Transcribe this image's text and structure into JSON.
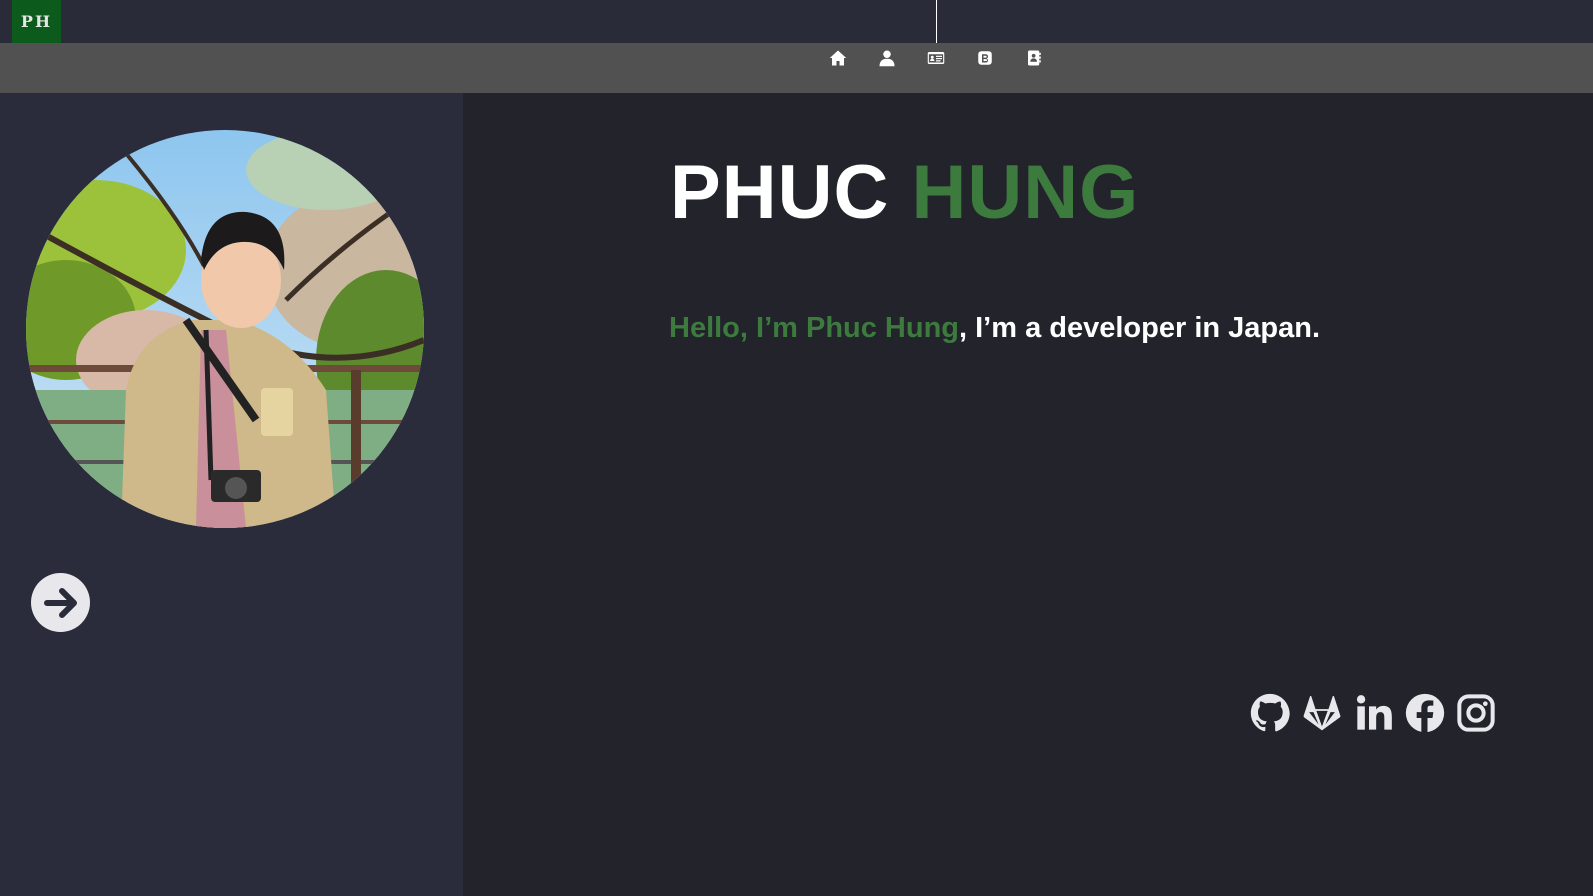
{
  "header": {
    "logo_text": "PH",
    "logo_color": "#0d5a1d"
  },
  "nav": {
    "items": [
      {
        "icon": "home-icon"
      },
      {
        "icon": "user-icon"
      },
      {
        "icon": "id-card-icon"
      },
      {
        "icon": "blog-icon"
      },
      {
        "icon": "contact-book-icon"
      }
    ]
  },
  "sidebar": {
    "avatar_alt": "Profile photo",
    "next_icon": "arrow-right-circle-icon"
  },
  "main": {
    "title_first": "PHUC",
    "title_second": "HUNG",
    "intro_highlight": "Hello, I’m Phuc Hung",
    "intro_rest": ", I’m a developer in Japan.",
    "accent_color": "#3c7a3e"
  },
  "social": [
    {
      "icon": "github-icon"
    },
    {
      "icon": "gitlab-icon"
    },
    {
      "icon": "linkedin-icon"
    },
    {
      "icon": "facebook-icon"
    },
    {
      "icon": "instagram-icon"
    }
  ]
}
